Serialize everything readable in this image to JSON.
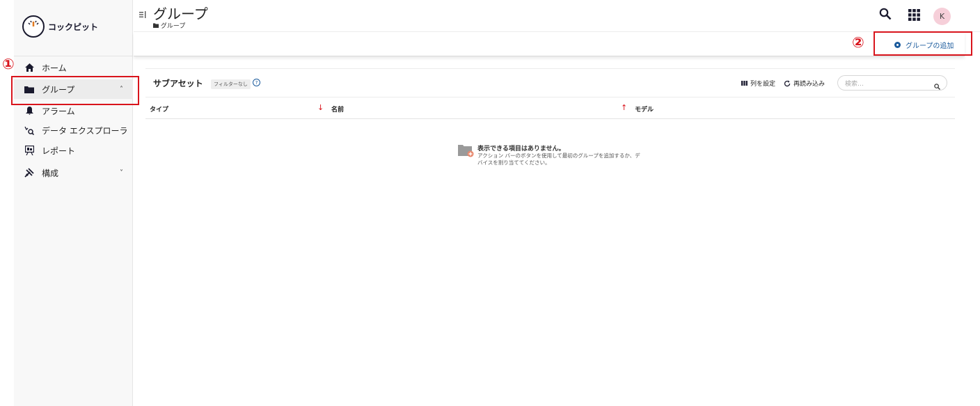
{
  "app": {
    "name": "コックピット"
  },
  "sidebar": {
    "items": [
      {
        "label": "ホーム",
        "icon": "home-icon"
      },
      {
        "label": "グループ",
        "icon": "folder-icon",
        "active": true,
        "chevron": "˄"
      },
      {
        "label": "アラーム",
        "icon": "bell-icon"
      },
      {
        "label": "データ エクスプローラ",
        "icon": "data-explorer-icon"
      },
      {
        "label": "レポート",
        "icon": "report-icon"
      },
      {
        "label": "構成",
        "icon": "configuration-icon",
        "chevron": "˅"
      }
    ]
  },
  "header": {
    "title": "グループ",
    "breadcrumb": "グループ",
    "avatar_initial": "K"
  },
  "actionbar": {
    "add_group_label": "グループの追加"
  },
  "subbar": {
    "title": "サブアセット",
    "filter_badge": "フィルターなし",
    "help": "?",
    "configure_columns": "列を設定",
    "reload": "再読み込み",
    "search_placeholder": "検索…"
  },
  "table": {
    "columns": [
      "タイプ",
      "名前",
      "モデル"
    ]
  },
  "empty_state": {
    "title": "表示できる項目はありません。",
    "description": "アクション バーのボタンを使用して最初のグループを追加するか、デバイスを割り当ててください。"
  },
  "annotations": {
    "one": "①",
    "two": "②"
  },
  "colors": {
    "accent": "#1a5a9c",
    "annotation": "#d9141c",
    "avatar_bg": "#f6cfd9"
  }
}
